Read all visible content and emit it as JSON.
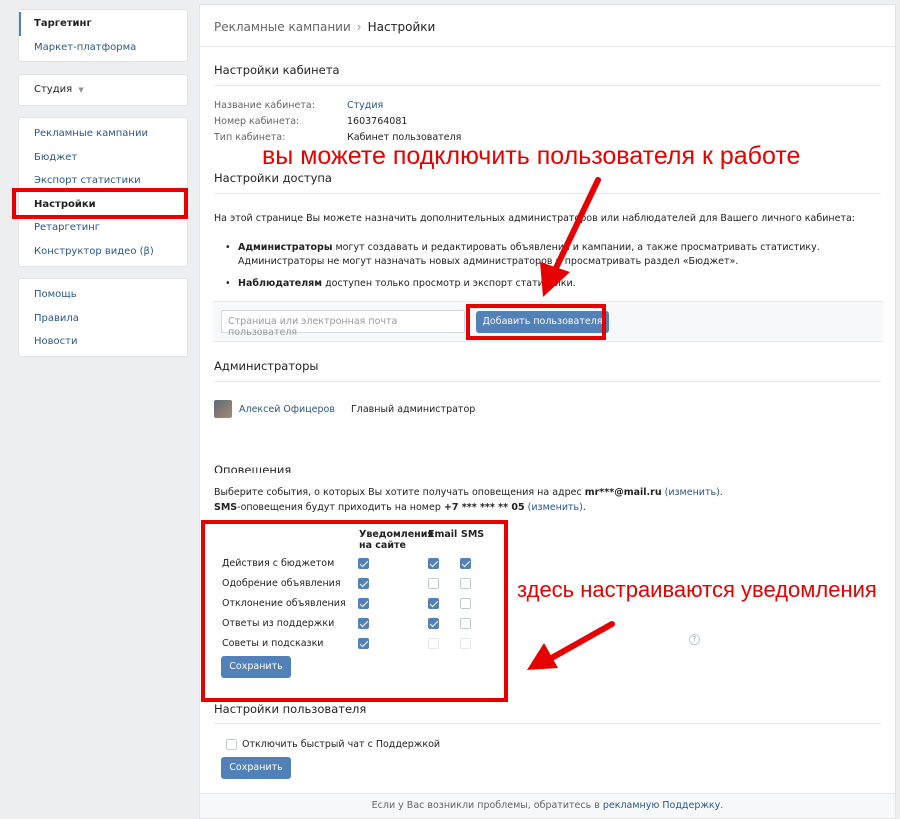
{
  "sidebar": {
    "group1": [
      "Таргетинг",
      "Маркет-платформа"
    ],
    "account_select": "Студия",
    "group3": [
      "Рекламные кампании",
      "Бюджет",
      "Экспорт статистики",
      "Настройки",
      "Ретаргетинг",
      "Конструктор видео (β)"
    ],
    "group4": [
      "Помощь",
      "Правила",
      "Новости"
    ]
  },
  "breadcrumb": {
    "parent": "Рекламные кампании",
    "separator": "›",
    "current": "Настройки"
  },
  "cabinet": {
    "title": "Настройки кабинета",
    "name_label": "Название кабинета:",
    "name_value": "Студия",
    "number_label": "Номер кабинета:",
    "number_value": "1603764081",
    "type_label": "Тип кабинета:",
    "type_value": "Кабинет пользователя"
  },
  "access": {
    "title": "Настройки доступа",
    "intro": "На этой странице Вы можете назначить дополнительных администраторов или наблюдателей для Вашего личного кабинета:",
    "admins_bold": "Администраторы",
    "admins_text": " могут создавать и редактировать объявления и кампании, а также просматривать статистику.",
    "admins_text2": "Администраторы не могут назначать новых администраторов и просматривать раздел «Бюджет».",
    "observers_bold": "Наблюдателям",
    "observers_text": " доступен только просмотр и экспорт статистики.",
    "input_placeholder": "Страница или электронная почта пользователя",
    "add_button": "Добавить пользователя"
  },
  "admins": {
    "title": "Администраторы",
    "name": "Алексей Офицеров",
    "role": "Главный администратор"
  },
  "notifications": {
    "title": "Оповещения",
    "line1_pre": "Выберите события, о которых Вы хотите получать оповещения на адрес ",
    "email": "mr***@mail.ru",
    "change": "(изменить)",
    "line1_post": ".",
    "sms_bold": "SMS",
    "line2_pre": "-оповещения будут приходить на номер ",
    "phone": "+7 *** *** ** 05",
    "line2_post": ".",
    "col_site_1": "Уведомления",
    "col_site_2": "на сайте",
    "col_email": "Email",
    "col_sms": "SMS",
    "rows": [
      {
        "label": "Действия с бюджетом",
        "site": true,
        "email": true,
        "sms": true
      },
      {
        "label": "Одобрение объявления",
        "site": true,
        "email": false,
        "sms": false
      },
      {
        "label": "Отклонение объявления",
        "site": true,
        "email": true,
        "sms": false
      },
      {
        "label": "Ответы из поддержки",
        "site": true,
        "email": true,
        "sms": false
      },
      {
        "label": "Советы и подсказки",
        "site": true,
        "email": false,
        "sms": false
      }
    ],
    "help": "?",
    "save": "Сохранить"
  },
  "user_settings": {
    "title": "Настройки пользователя",
    "checkbox_label": "Отключить быстрый чат с Поддержкой",
    "save": "Сохранить"
  },
  "footer": {
    "pre": "Если у Вас возникли проблемы, обратитесь в ",
    "link": "рекламную Поддержку",
    "post": "."
  },
  "annotations": {
    "top": "вы можете подключить пользователя к работе",
    "right": "здесь настраиваются уведомления"
  },
  "colors": {
    "accent": "#5181b8",
    "link": "#2a5885",
    "annotation": "#e60000"
  }
}
